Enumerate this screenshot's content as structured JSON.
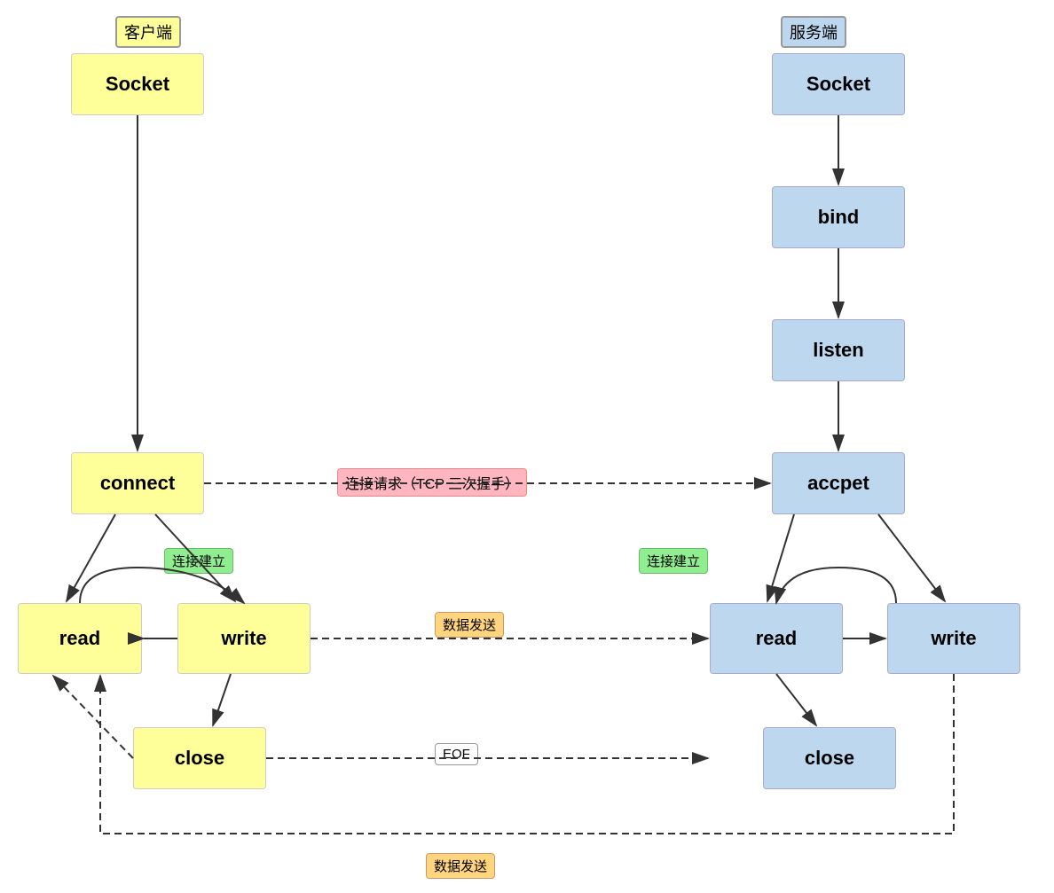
{
  "client_label": "客户端",
  "server_label": "服务端",
  "client_socket": "Socket",
  "client_connect": "connect",
  "client_read": "read",
  "client_write": "write",
  "client_close": "close",
  "server_socket": "Socket",
  "server_bind": "bind",
  "server_listen": "listen",
  "server_accept": "accpet",
  "server_read": "read",
  "server_write": "write",
  "server_close": "close",
  "label_tcp": "连接请求（TCP 三次握手）",
  "label_conn1": "连接建立",
  "label_conn2": "连接建立",
  "label_data_send1": "数据发送",
  "label_eof": "EOF",
  "label_data_send2": "数据发送",
  "colors": {
    "yellow": "#FFFF99",
    "blue": "#BDD7EE",
    "pink": "#FFB6C1",
    "green": "#90EE90",
    "orange": "#FFD580"
  }
}
